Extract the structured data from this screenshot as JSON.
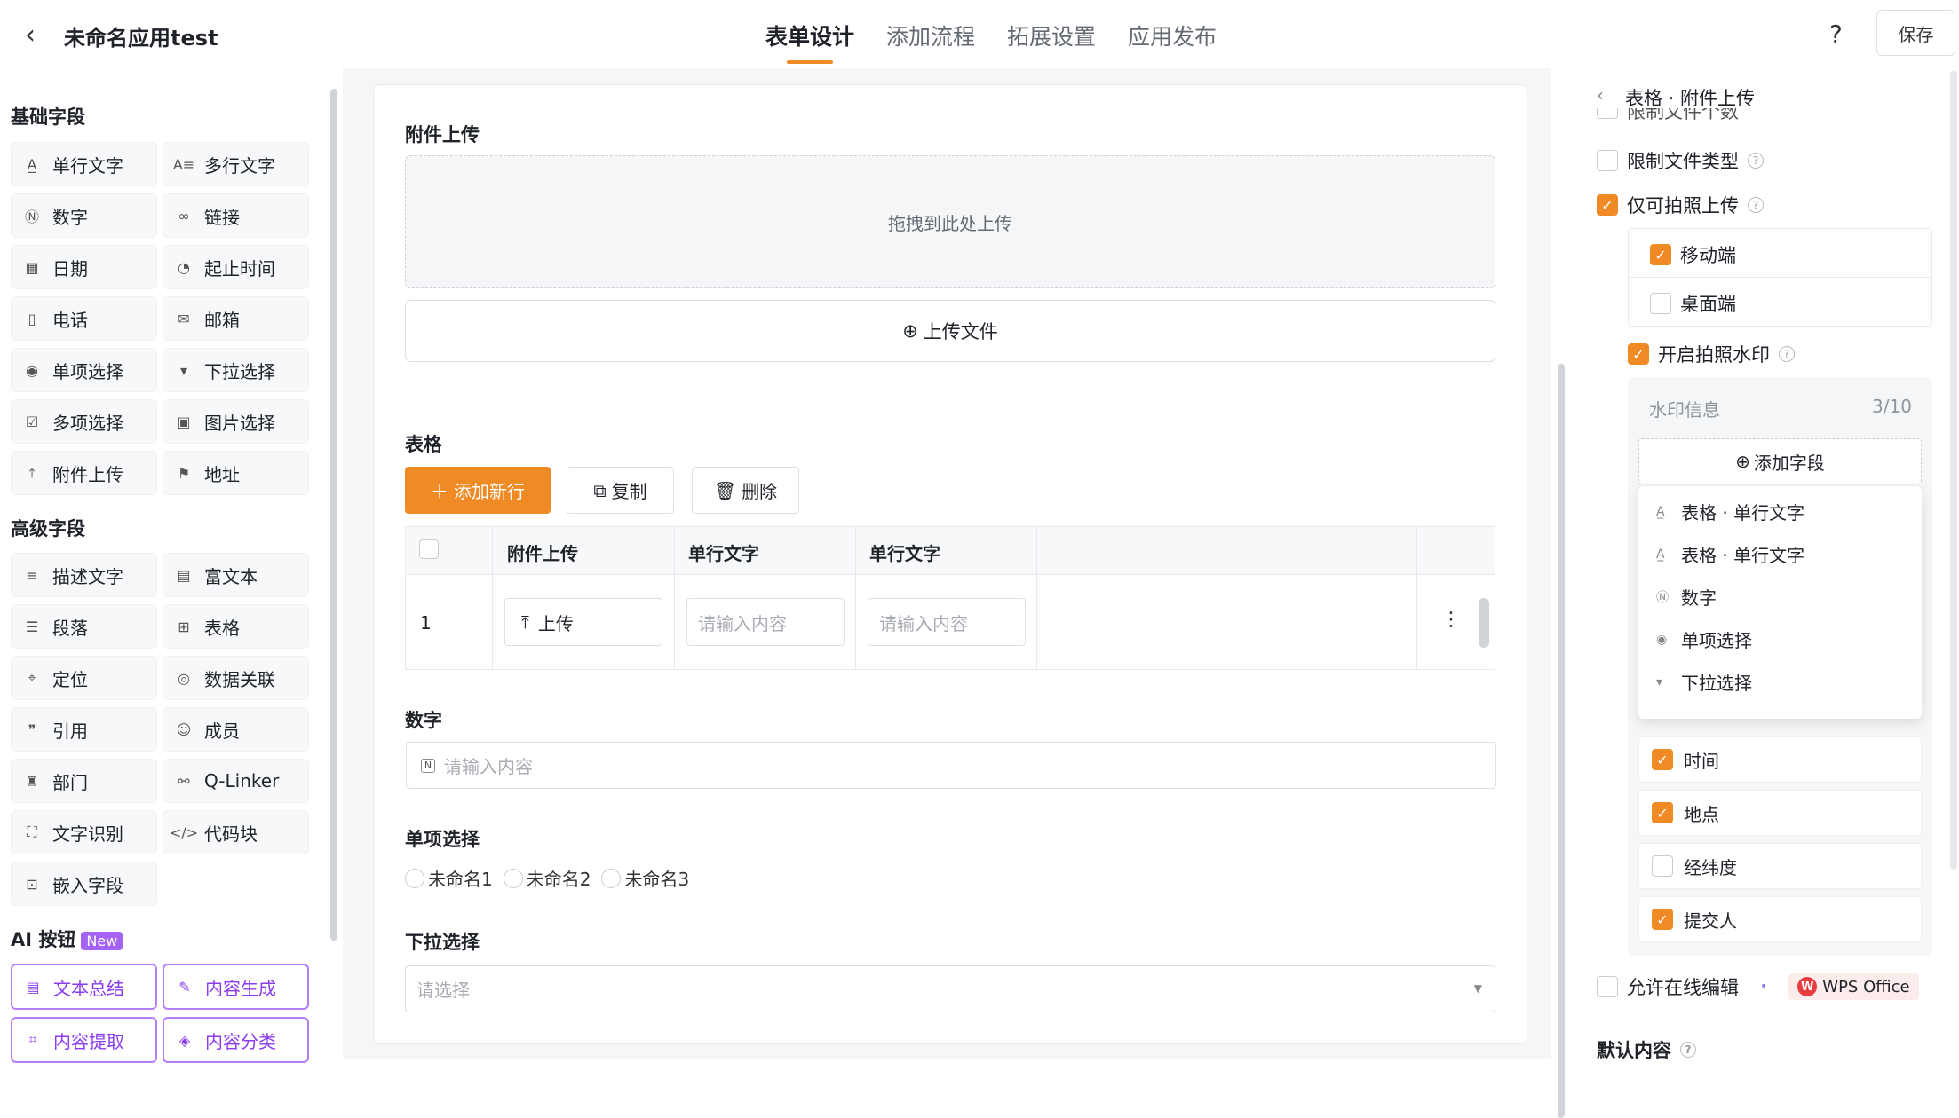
{
  "header": {
    "app_title": "未命名应用test",
    "tabs": [
      "表单设计",
      "添加流程",
      "拓展设置",
      "应用发布"
    ],
    "active_tab": "表单设计",
    "save_label": "保存"
  },
  "sidebar": {
    "basic_title": "基础字段",
    "basic": [
      {
        "label": "单行文字",
        "icon": "single-line-text-icon"
      },
      {
        "label": "多行文字",
        "icon": "multi-line-text-icon"
      },
      {
        "label": "数字",
        "icon": "number-icon"
      },
      {
        "label": "链接",
        "icon": "link-icon"
      },
      {
        "label": "日期",
        "icon": "date-icon"
      },
      {
        "label": "起止时间",
        "icon": "time-range-icon"
      },
      {
        "label": "电话",
        "icon": "phone-icon"
      },
      {
        "label": "邮箱",
        "icon": "email-icon"
      },
      {
        "label": "单项选择",
        "icon": "radio-icon"
      },
      {
        "label": "下拉选择",
        "icon": "dropdown-icon"
      },
      {
        "label": "多项选择",
        "icon": "checkbox-icon"
      },
      {
        "label": "图片选择",
        "icon": "image-icon"
      },
      {
        "label": "附件上传",
        "icon": "upload-icon"
      },
      {
        "label": "地址",
        "icon": "address-icon"
      }
    ],
    "advanced_title": "高级字段",
    "advanced": [
      {
        "label": "描述文字",
        "icon": "description-icon"
      },
      {
        "label": "富文本",
        "icon": "rich-text-icon"
      },
      {
        "label": "段落",
        "icon": "paragraph-icon"
      },
      {
        "label": "表格",
        "icon": "table-icon"
      },
      {
        "label": "定位",
        "icon": "location-icon"
      },
      {
        "label": "数据关联",
        "icon": "data-link-icon"
      },
      {
        "label": "引用",
        "icon": "reference-icon"
      },
      {
        "label": "成员",
        "icon": "member-icon"
      },
      {
        "label": "部门",
        "icon": "department-icon"
      },
      {
        "label": "Q-Linker",
        "icon": "qlinker-icon"
      },
      {
        "label": "文字识别",
        "icon": "ocr-icon"
      },
      {
        "label": "代码块",
        "icon": "code-icon"
      },
      {
        "label": "嵌入字段",
        "icon": "embed-icon"
      }
    ],
    "ai_title": "AI 按钮",
    "ai_badge": "New",
    "ai": [
      {
        "label": "文本总结",
        "icon": "summary-icon"
      },
      {
        "label": "内容生成",
        "icon": "generate-icon"
      },
      {
        "label": "内容提取",
        "icon": "extract-icon"
      },
      {
        "label": "内容分类",
        "icon": "classify-icon"
      }
    ]
  },
  "form": {
    "attachment": {
      "label": "附件上传",
      "drop_text": "拖拽到此处上传",
      "upload_button": "上传文件"
    },
    "table": {
      "label": "表格",
      "add_row": "添加新行",
      "copy": "复制",
      "delete": "删除",
      "columns": [
        "附件上传",
        "单行文字",
        "单行文字"
      ],
      "row_index": "1",
      "upload_cell": "上传",
      "placeholder": "请输入内容"
    },
    "number": {
      "label": "数字",
      "placeholder": "请输入内容"
    },
    "radio": {
      "label": "单项选择",
      "options": [
        "未命名1",
        "未命名2",
        "未命名3"
      ]
    },
    "select": {
      "label": "下拉选择",
      "placeholder": "请选择"
    }
  },
  "panel": {
    "title": "表格 · 附件上传",
    "clipped_text": "限制文件个数",
    "limit_type": "限制文件类型",
    "photo_only": "仅可拍照上传",
    "mobile": "移动端",
    "desktop": "桌面端",
    "watermark": "开启拍照水印",
    "wm_info": "水印信息",
    "wm_count": "3/10",
    "add_field": "添加字段",
    "menu": [
      {
        "label": "表格 · 单行文字",
        "icon": "single-line-text-icon"
      },
      {
        "label": "表格 · 单行文字",
        "icon": "single-line-text-icon"
      },
      {
        "label": "数字",
        "icon": "number-icon"
      },
      {
        "label": "单项选择",
        "icon": "radio-icon"
      },
      {
        "label": "下拉选择",
        "icon": "dropdown-icon"
      }
    ],
    "wm_items": [
      {
        "label": "时间",
        "checked": true
      },
      {
        "label": "地点",
        "checked": true
      },
      {
        "label": "经纬度",
        "checked": false
      },
      {
        "label": "提交人",
        "checked": true
      }
    ],
    "online_edit": "允许在线编辑",
    "wps": "WPS Office",
    "default_content": "默认内容"
  },
  "colors": {
    "accent": "#f08a24",
    "ai": "#8b3df0",
    "ai_badge": "#a463f2"
  }
}
